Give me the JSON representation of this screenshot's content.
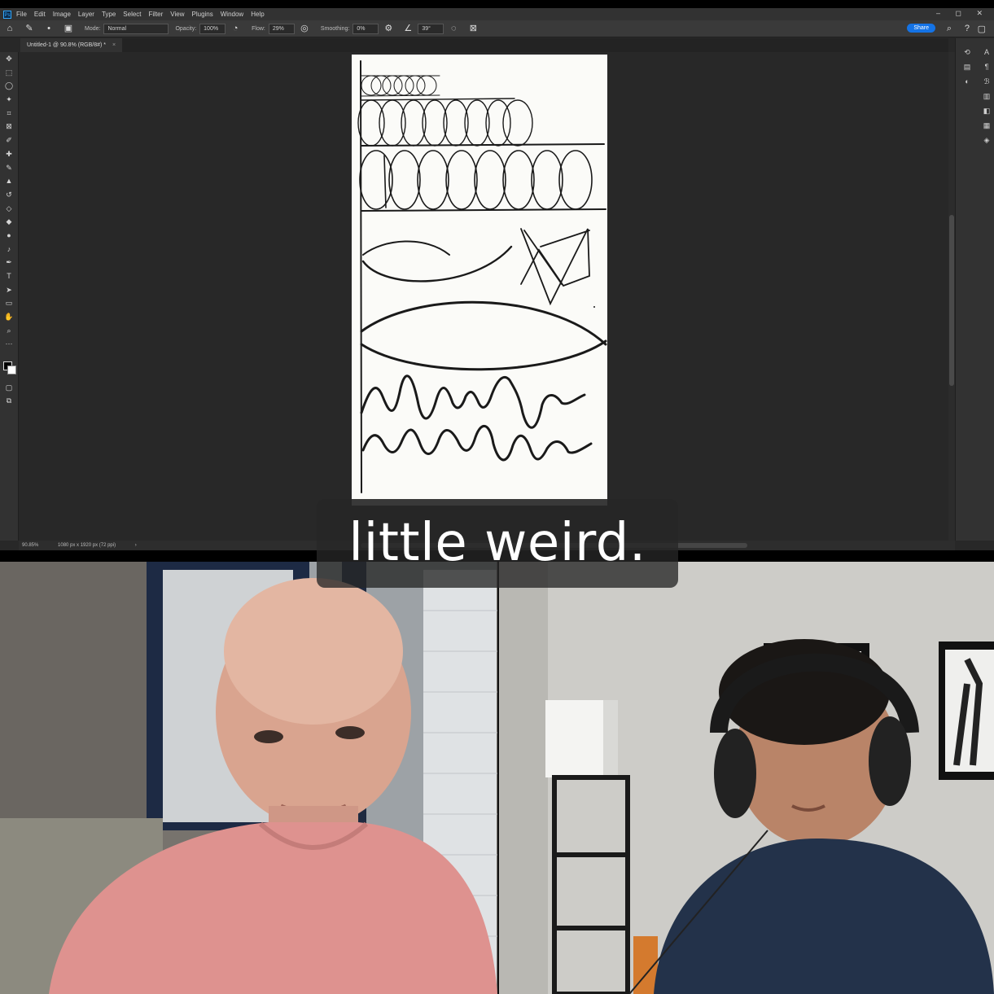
{
  "app": {
    "logo_text": "Ps",
    "menu": [
      "File",
      "Edit",
      "Image",
      "Layer",
      "Type",
      "Select",
      "Filter",
      "View",
      "Plugins",
      "Window",
      "Help"
    ],
    "window_controls": "– ◻ ✕"
  },
  "options_bar": {
    "mode_label": "Mode:",
    "mode_value": "Normal",
    "opacity_label": "Opacity:",
    "opacity_value": "100%",
    "flow_label": "Flow:",
    "flow_value": "29%",
    "smoothing_label": "Smoothing:",
    "smoothing_value": "0%",
    "angle_value": "39°",
    "share_label": "Share"
  },
  "document": {
    "tab_title": "Untitled-1 @ 90.8% (RGB/8#) *",
    "close_glyph": "×"
  },
  "status_bar": {
    "zoom": "90.85%",
    "doc_info": "1080 px x 1920 px (72 ppi)",
    "arrow": "›"
  },
  "caption": {
    "text": "little weird."
  },
  "icons": {
    "home": "home-icon",
    "brush": "brush-icon",
    "search": "search-icon",
    "help": "help-icon",
    "workspace": "workspace-icon"
  }
}
